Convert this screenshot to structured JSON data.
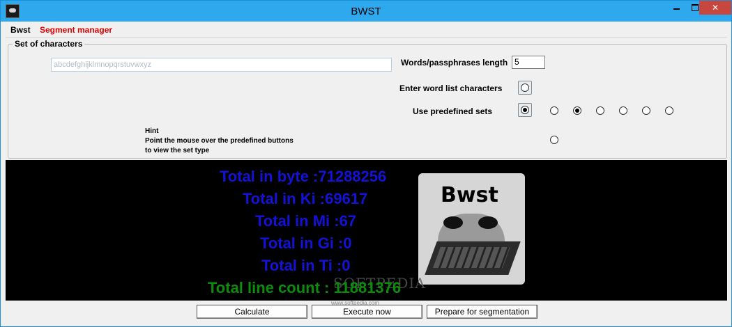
{
  "window": {
    "title": "BWST",
    "minimize": "",
    "maximize": "",
    "close": "✕"
  },
  "menu": {
    "items": [
      {
        "label": "Bwst"
      },
      {
        "label": "Segment manager"
      }
    ],
    "colors": {
      "segment_manager": "#e00000"
    }
  },
  "set_of_characters": {
    "title": "Set of characters",
    "chars_value": "abcdefghijklmnopqrstuvwxyz",
    "length_label": "Words/passphrases length",
    "length_value": "5",
    "word_list_label": "Enter word list characters",
    "predefined_label": "Use predefined sets",
    "hint_title": "Hint",
    "hint_line1": "Point the mouse over the predefined buttons",
    "hint_line2": "to view the set type",
    "predefined_radios": [
      {
        "checked": true
      },
      {
        "checked": false
      },
      {
        "checked": true
      },
      {
        "checked": false
      },
      {
        "checked": false
      },
      {
        "checked": false
      },
      {
        "checked": false
      },
      {
        "checked": false
      }
    ]
  },
  "results": {
    "total_byte": "Total in byte :71288256",
    "total_ki": "Total in Ki :69617",
    "total_mi": "Total in Mi :67",
    "total_gi": "Total in Gi :0",
    "total_ti": "Total in Ti :0",
    "total_lines": "Total line count : 11881376",
    "colors": {
      "totals": "#1313d8",
      "line_count": "#0c8c0c",
      "background": "#000000"
    }
  },
  "logo": {
    "text": "Bwst"
  },
  "watermark": {
    "text": "SOFTPEDIA",
    "url": "www.softpedia.com"
  },
  "buttons": {
    "calculate": "Calculate",
    "execute": "Execute now",
    "prepare": "Prepare for segmentation"
  }
}
